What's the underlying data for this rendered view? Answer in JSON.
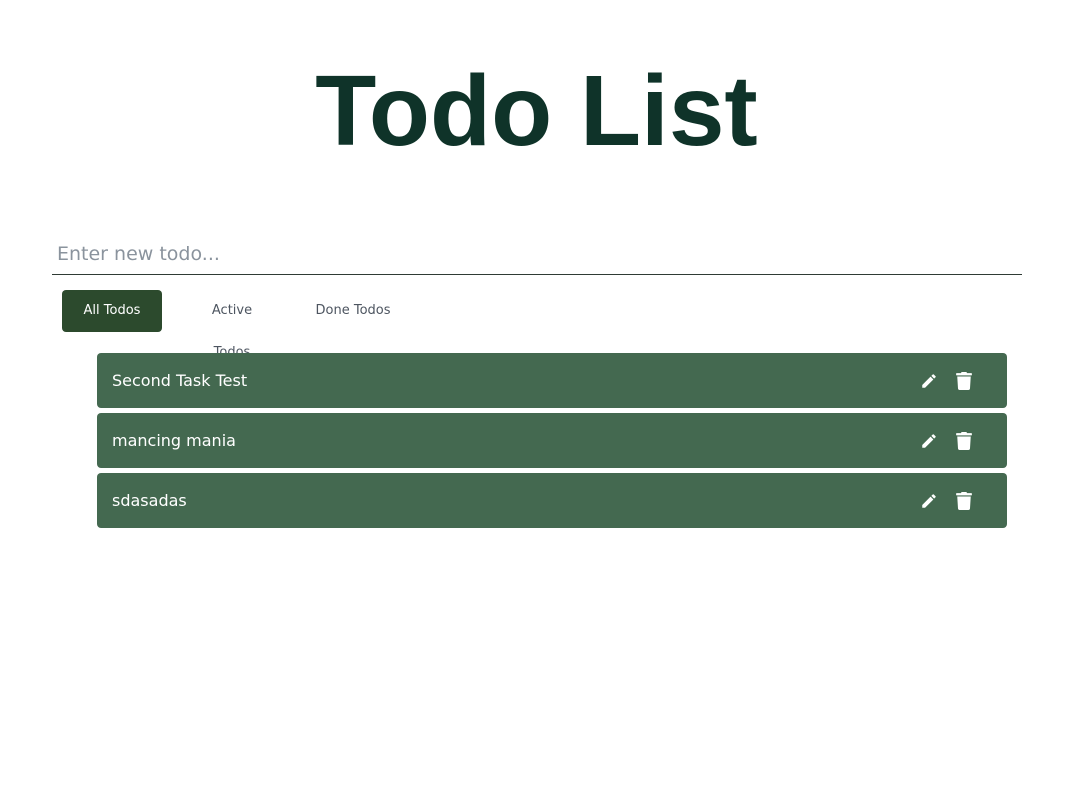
{
  "header": {
    "title": "Todo List"
  },
  "new_todo": {
    "placeholder": "Enter new todo...",
    "value": ""
  },
  "filters": [
    {
      "label": "All Todos",
      "active": true
    },
    {
      "label": "Active Todos",
      "active": false
    },
    {
      "label": "Done Todos",
      "active": false
    }
  ],
  "todos": [
    {
      "text": "Second Task Test",
      "edit_icon": "pencil-icon",
      "delete_icon": "trash-icon"
    },
    {
      "text": "mancing mania",
      "edit_icon": "pencil-icon",
      "delete_icon": "trash-icon"
    },
    {
      "text": "sdasadas",
      "edit_icon": "pencil-icon",
      "delete_icon": "trash-icon"
    }
  ],
  "colors": {
    "title": "#0f3329",
    "active_tab_bg": "#2c4a2d",
    "todo_item_bg": "#446950",
    "icon": "#ffffff"
  }
}
